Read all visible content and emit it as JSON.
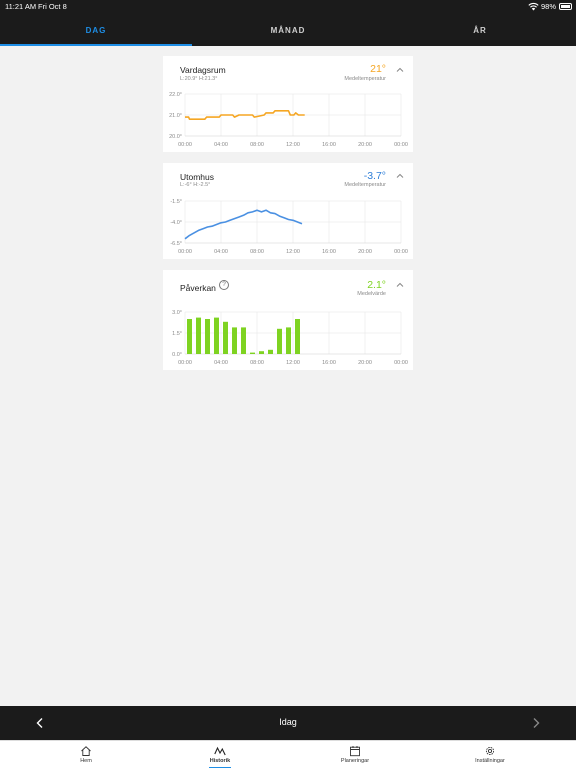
{
  "status": {
    "time": "11:21 AM",
    "date": "Fri Oct 8",
    "battery": "98%"
  },
  "tabs": [
    {
      "label": "DAG",
      "active": true
    },
    {
      "label": "MÅNAD",
      "active": false
    },
    {
      "label": "ÅR",
      "active": false
    }
  ],
  "cards": {
    "vardagsrum": {
      "title": "Vardagsrum",
      "subtitle": "L:20.9° H:21.3°",
      "value": "21°",
      "value_label": "Medeltemperatur",
      "value_color": "#f5a623"
    },
    "utomhus": {
      "title": "Utomhus",
      "subtitle": "L:-6° H:-2.5°",
      "value": "-3.7°",
      "value_label": "Medeltemperatur",
      "value_color": "#2f7fd8"
    },
    "paverkan": {
      "title": "Påverkan",
      "help": "?",
      "value": "2.1°",
      "value_label": "Medelvärde",
      "value_color": "#7ed321"
    }
  },
  "chart_data": [
    {
      "type": "line",
      "name": "Vardagsrum",
      "color": "#f5a623",
      "x_ticks": [
        "00:00",
        "04:00",
        "08:00",
        "12:00",
        "16:00",
        "20:00",
        "00:00"
      ],
      "y_ticks": [
        "22.0°",
        "21.0°",
        "20.0°"
      ],
      "ylim": [
        20.0,
        22.0
      ],
      "xlim": [
        0,
        24
      ],
      "x": [
        0,
        0.4,
        0.5,
        2.2,
        2.4,
        3.8,
        4.0,
        5.3,
        5.5,
        6.0,
        6.2,
        7.5,
        7.7,
        8.8,
        9.0,
        9.8,
        10.0,
        11.5,
        11.7,
        12.1,
        12.3,
        12.6,
        12.8,
        13.3
      ],
      "y": [
        20.9,
        20.9,
        20.8,
        20.8,
        20.9,
        20.9,
        21.0,
        21.0,
        20.9,
        21.0,
        21.0,
        21.0,
        20.9,
        21.0,
        21.1,
        21.1,
        21.2,
        21.2,
        21.0,
        21.0,
        21.1,
        21.0,
        21.0,
        21.0
      ]
    },
    {
      "type": "line",
      "name": "Utomhus",
      "color": "#4a90e2",
      "x_ticks": [
        "00:00",
        "04:00",
        "08:00",
        "12:00",
        "16:00",
        "20:00",
        "00:00"
      ],
      "y_ticks": [
        "-1.5°",
        "-4.0°",
        "-6.5°"
      ],
      "ylim": [
        -6.5,
        -1.5
      ],
      "xlim": [
        0,
        24
      ],
      "x": [
        0,
        0.5,
        1,
        1.5,
        2,
        2.5,
        3,
        3.5,
        4,
        4.5,
        5,
        5.5,
        6,
        6.5,
        7,
        7.5,
        8,
        8.5,
        9,
        9.5,
        10,
        10.5,
        11,
        11.5,
        12,
        12.5,
        13
      ],
      "y": [
        -6.0,
        -5.6,
        -5.3,
        -5.0,
        -4.8,
        -4.6,
        -4.5,
        -4.3,
        -4.1,
        -4.0,
        -3.8,
        -3.6,
        -3.4,
        -3.2,
        -2.9,
        -2.8,
        -2.6,
        -2.8,
        -2.6,
        -2.9,
        -3.0,
        -3.3,
        -3.5,
        -3.7,
        -3.8,
        -4.0,
        -4.2
      ]
    },
    {
      "type": "bar",
      "name": "Påverkan",
      "color": "#7ed321",
      "x_ticks": [
        "00:00",
        "04:00",
        "08:00",
        "12:00",
        "16:00",
        "20:00",
        "00:00"
      ],
      "y_ticks": [
        "3.0°",
        "1.5°",
        "0.0°"
      ],
      "ylim": [
        0,
        3.0
      ],
      "xlim": [
        0,
        24
      ],
      "x": [
        0.5,
        1.5,
        2.5,
        3.5,
        4.5,
        5.5,
        6.5,
        7.5,
        8.5,
        9.5,
        10.5,
        11.5,
        12.5
      ],
      "values": [
        2.5,
        2.6,
        2.5,
        2.6,
        2.3,
        1.9,
        1.9,
        0.1,
        0.2,
        0.3,
        1.8,
        1.9,
        2.5
      ]
    }
  ],
  "nav": {
    "label": "Idag"
  },
  "bottom_nav": [
    {
      "label": "Hem",
      "icon": "home-icon"
    },
    {
      "label": "Historik",
      "icon": "history-icon",
      "active": true
    },
    {
      "label": "Planeringar",
      "icon": "calendar-icon"
    },
    {
      "label": "Inställningar",
      "icon": "gear-icon"
    }
  ]
}
